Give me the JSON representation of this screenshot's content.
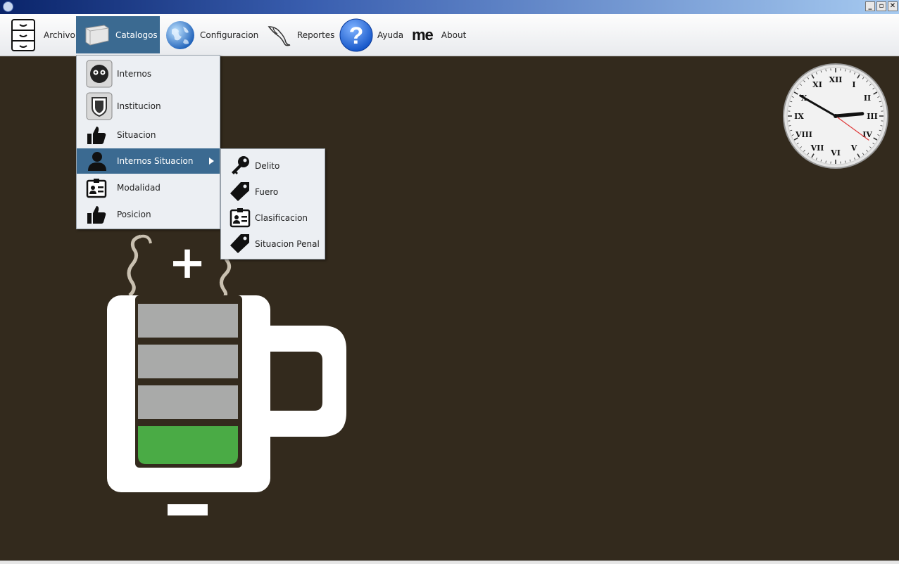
{
  "window": {
    "minimize": "_",
    "restore": "▫",
    "close": "✕"
  },
  "menubar": {
    "archivo": "Archivo",
    "catalogos": "Catalogos",
    "configuracion": "Configuracion",
    "reportes": "Reportes",
    "ayuda": "Ayuda",
    "me_logo": "me",
    "about": "About"
  },
  "catalogos_menu": {
    "items": [
      "Internos",
      "Institucion",
      "Situacion",
      "Internos Situacion",
      "Modalidad",
      "Posicion"
    ],
    "active_index": 3
  },
  "submenu": {
    "items": [
      "Delito",
      "Fuero",
      "Clasificacion",
      "Situacion Penal"
    ]
  },
  "clock": {
    "numerals": [
      "XII",
      "I",
      "II",
      "III",
      "IV",
      "V",
      "VI",
      "VII",
      "VIII",
      "IX",
      "X",
      "XI"
    ],
    "time": {
      "hour": 2,
      "minute": 50,
      "second": 21
    }
  },
  "mug": {
    "plus": "+",
    "minus": "−",
    "charge_level": 0.25
  },
  "colors": {
    "desktop_bg": "#332a1d",
    "menu_highlight": "#3b6a91",
    "battery_green": "#4aab45",
    "battery_gray": "#a9aaa9"
  }
}
